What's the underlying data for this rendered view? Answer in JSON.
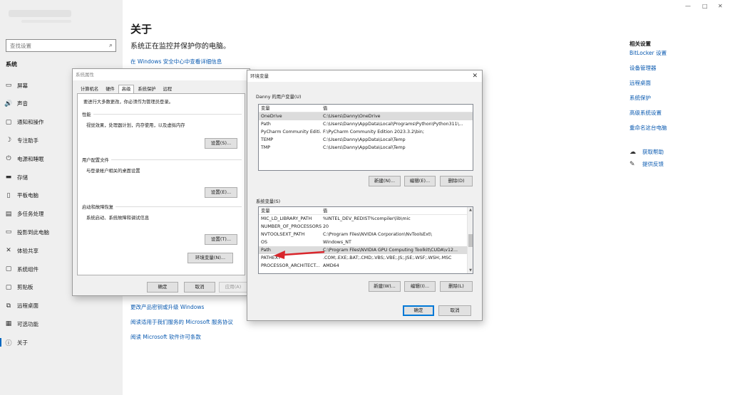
{
  "window": {
    "minimize": "—",
    "maximize": "□",
    "close": "✕"
  },
  "sidebar": {
    "search_placeholder": "查找设置",
    "section": "系统",
    "items": [
      {
        "label": "屏幕",
        "icon": "display-icon",
        "glyph": "▭"
      },
      {
        "label": "声音",
        "icon": "sound-icon",
        "glyph": "🔊"
      },
      {
        "label": "通知和操作",
        "icon": "notification-icon",
        "glyph": "▢"
      },
      {
        "label": "专注助手",
        "icon": "focus-icon",
        "glyph": "☽"
      },
      {
        "label": "电源和睡眠",
        "icon": "power-icon",
        "glyph": "⏻"
      },
      {
        "label": "存储",
        "icon": "storage-icon",
        "glyph": "▬"
      },
      {
        "label": "平板电脑",
        "icon": "tablet-icon",
        "glyph": "▯"
      },
      {
        "label": "多任务处理",
        "icon": "multitask-icon",
        "glyph": "▤"
      },
      {
        "label": "投影到此电脑",
        "icon": "project-icon",
        "glyph": "▭"
      },
      {
        "label": "体验共享",
        "icon": "share-icon",
        "glyph": "✕"
      },
      {
        "label": "系统组件",
        "icon": "components-icon",
        "glyph": "▢"
      },
      {
        "label": "剪贴板",
        "icon": "clipboard-icon",
        "glyph": "▢"
      },
      {
        "label": "远程桌面",
        "icon": "remote-icon",
        "glyph": "⧉"
      },
      {
        "label": "可选功能",
        "icon": "optional-icon",
        "glyph": "▦"
      },
      {
        "label": "关于",
        "icon": "info-icon",
        "glyph": "ⓘ"
      }
    ]
  },
  "main": {
    "title": "关于",
    "subtitle": "系统正在监控并保护你的电脑。",
    "security_link": "在 Windows 安全中心中查看详细信息",
    "bottom_links": [
      "更改产品密钥或升级 Windows",
      "阅读适用于我们服务的 Microsoft 服务协议",
      "阅读 Microsoft 软件许可条款"
    ]
  },
  "related": {
    "title": "相关设置",
    "links": [
      "BitLocker 设置",
      "设备管理器",
      "远程桌面",
      "系统保护",
      "高级系统设置",
      "重命名这台电脑"
    ],
    "help": [
      {
        "label": "获取帮助",
        "icon": "help-icon",
        "glyph": "☁"
      },
      {
        "label": "提供反馈",
        "icon": "feedback-icon",
        "glyph": "✎"
      }
    ]
  },
  "sysprop": {
    "title": "系统属性",
    "tabs": [
      "计算机名",
      "硬件",
      "高级",
      "系统保护",
      "远程"
    ],
    "active_tab": 2,
    "note": "要进行大多数更改，你必须作为管理员登录。",
    "groups": [
      {
        "title": "性能",
        "desc": "视觉效果，处理器计划，内存使用，以及虚拟内存",
        "button": "设置(S)..."
      },
      {
        "title": "用户配置文件",
        "desc": "与登录帐户相关的桌面设置",
        "button": "设置(E)..."
      },
      {
        "title": "启动和故障恢复",
        "desc": "系统启动、系统故障和调试信息",
        "button": "设置(T)..."
      }
    ],
    "env_button": "环境变量(N)...",
    "ok": "确定",
    "cancel": "取消",
    "apply": "应用(A)"
  },
  "envvars": {
    "title": "环境变量",
    "user_label": "Danny 的用户变量(U)",
    "sys_label": "系统变量(S)",
    "col_var": "变量",
    "col_val": "值",
    "user_vars": [
      {
        "name": "OneDrive",
        "value": "C:\\Users\\Danny\\OneDrive"
      },
      {
        "name": "Path",
        "value": "C:\\Users\\Danny\\AppData\\Local\\Programs\\Python\\Python311\\..."
      },
      {
        "name": "PyCharm Community Editi...",
        "value": "F:\\PyCharm Community Edition 2023.3.2\\bin;"
      },
      {
        "name": "TEMP",
        "value": "C:\\Users\\Danny\\AppData\\Local\\Temp"
      },
      {
        "name": "TMP",
        "value": "C:\\Users\\Danny\\AppData\\Local\\Temp"
      }
    ],
    "sys_vars": [
      {
        "name": "MIC_LD_LIBRARY_PATH",
        "value": "%INTEL_DEV_REDIST%compiler\\lib\\mic"
      },
      {
        "name": "NUMBER_OF_PROCESSORS",
        "value": "20"
      },
      {
        "name": "NVTOOLSEXT_PATH",
        "value": "C:\\Program Files\\NVIDIA Corporation\\NvToolsExt\\"
      },
      {
        "name": "OS",
        "value": "Windows_NT"
      },
      {
        "name": "Path",
        "value": "C:\\Program Files\\NVIDIA GPU Computing Toolkit\\CUDA\\v12..."
      },
      {
        "name": "PATHEXT",
        "value": ".COM;.EXE;.BAT;.CMD;.VBS;.VBE;.JS;.JSE;.WSF;.WSH;.MSC"
      },
      {
        "name": "PROCESSOR_ARCHITECT...",
        "value": "AMD64"
      }
    ],
    "selected_sys_row": 4,
    "user_buttons": [
      "新建(N)...",
      "编辑(E)...",
      "删除(D)"
    ],
    "sys_buttons": [
      "新建(W)...",
      "编辑(I)...",
      "删除(L)"
    ],
    "ok": "确定",
    "cancel": "取消",
    "arrow_color": "#d9262c"
  }
}
